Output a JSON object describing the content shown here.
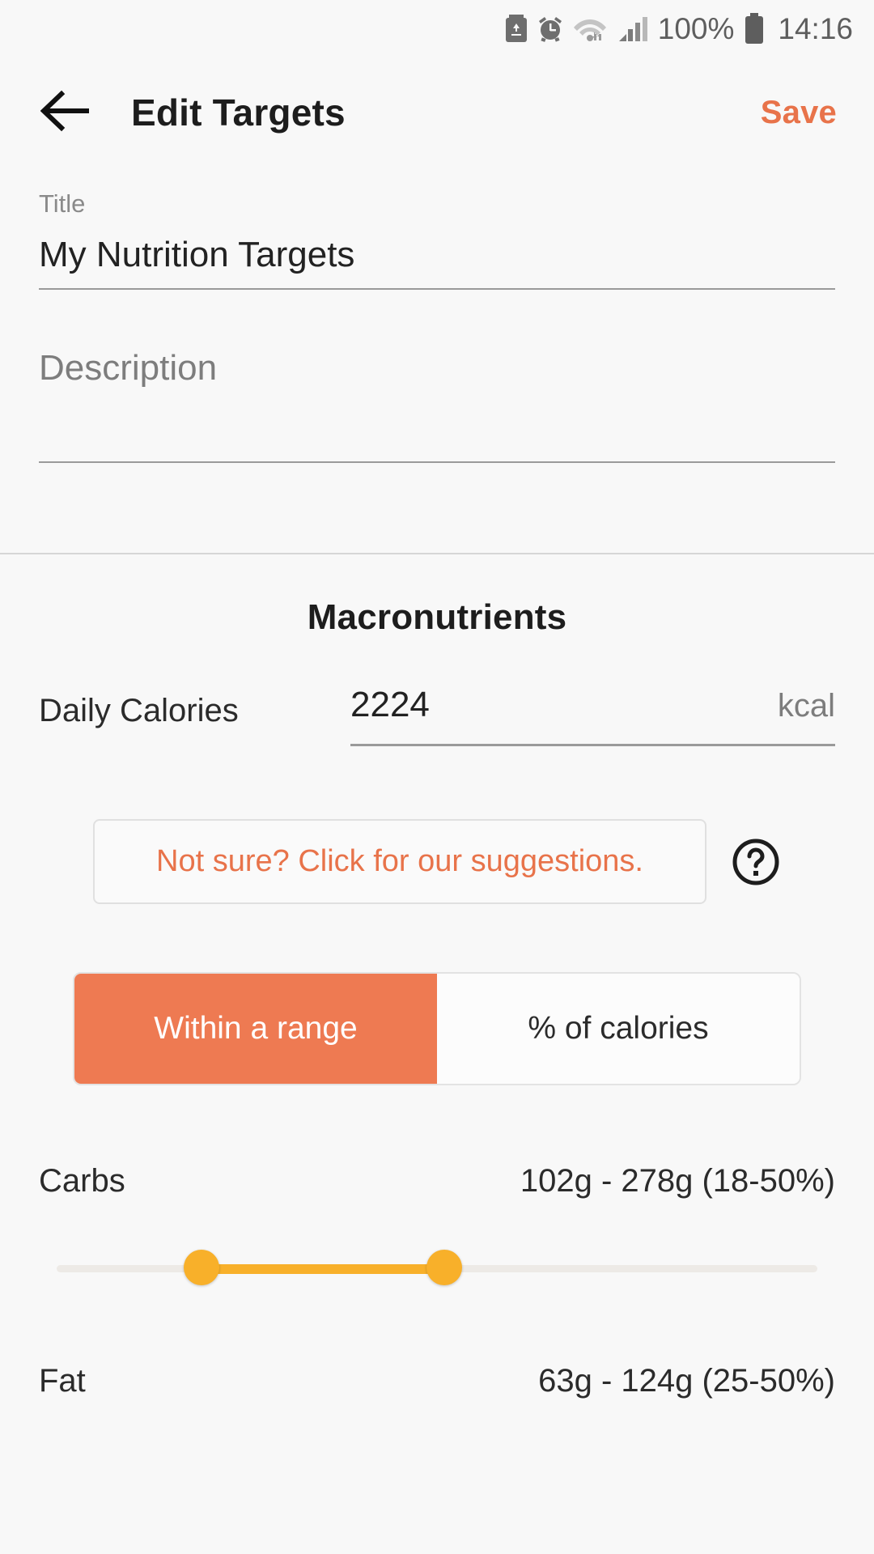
{
  "statusbar": {
    "icons": [
      "battery-saver-icon",
      "alarm-icon",
      "wifi-icon",
      "cellular-signal-icon"
    ],
    "battery_percent": "100%",
    "time": "14:16"
  },
  "appbar": {
    "back_icon": "back-arrow-icon",
    "title": "Edit Targets",
    "save_label": "Save",
    "save_color": "#E8734A"
  },
  "form": {
    "title_field": {
      "label": "Title",
      "value": "My Nutrition Targets"
    },
    "description_field": {
      "placeholder": "Description",
      "value": ""
    }
  },
  "macronutrients": {
    "section_title": "Macronutrients",
    "calories": {
      "label": "Daily Calories",
      "value": "2224",
      "unit": "kcal"
    },
    "suggestion": {
      "text": "Not sure? Click for our suggestions.",
      "help_icon": "help-circle-icon"
    },
    "mode_toggle": {
      "options": [
        {
          "label": "Within a range",
          "active": true
        },
        {
          "label": "% of calories",
          "active": false
        }
      ],
      "active_color": "#EE7A52"
    },
    "rows": [
      {
        "name": "Carbs",
        "value": "102g - 278g (18-50%)",
        "slider": {
          "low_pct": 19,
          "high_pct": 51,
          "color": "#F8B02A"
        }
      },
      {
        "name": "Fat",
        "value": "63g - 124g (25-50%)"
      }
    ]
  }
}
